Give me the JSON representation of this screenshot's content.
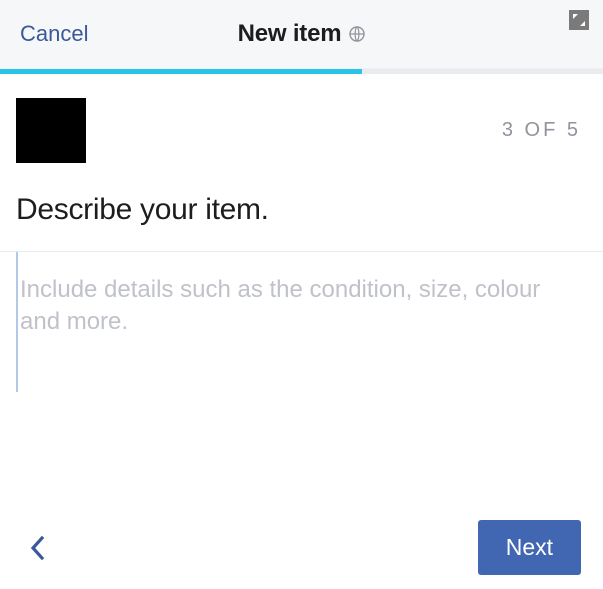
{
  "header": {
    "cancel_label": "Cancel",
    "title": "New item",
    "privacy_icon": "globe-icon"
  },
  "progress": {
    "percent": 60
  },
  "step": {
    "counter": "3 OF 5"
  },
  "prompt": {
    "heading": "Describe your item."
  },
  "description": {
    "value": "",
    "placeholder": "Include details such as the condition, size, colour and more."
  },
  "footer": {
    "next_label": "Next"
  }
}
